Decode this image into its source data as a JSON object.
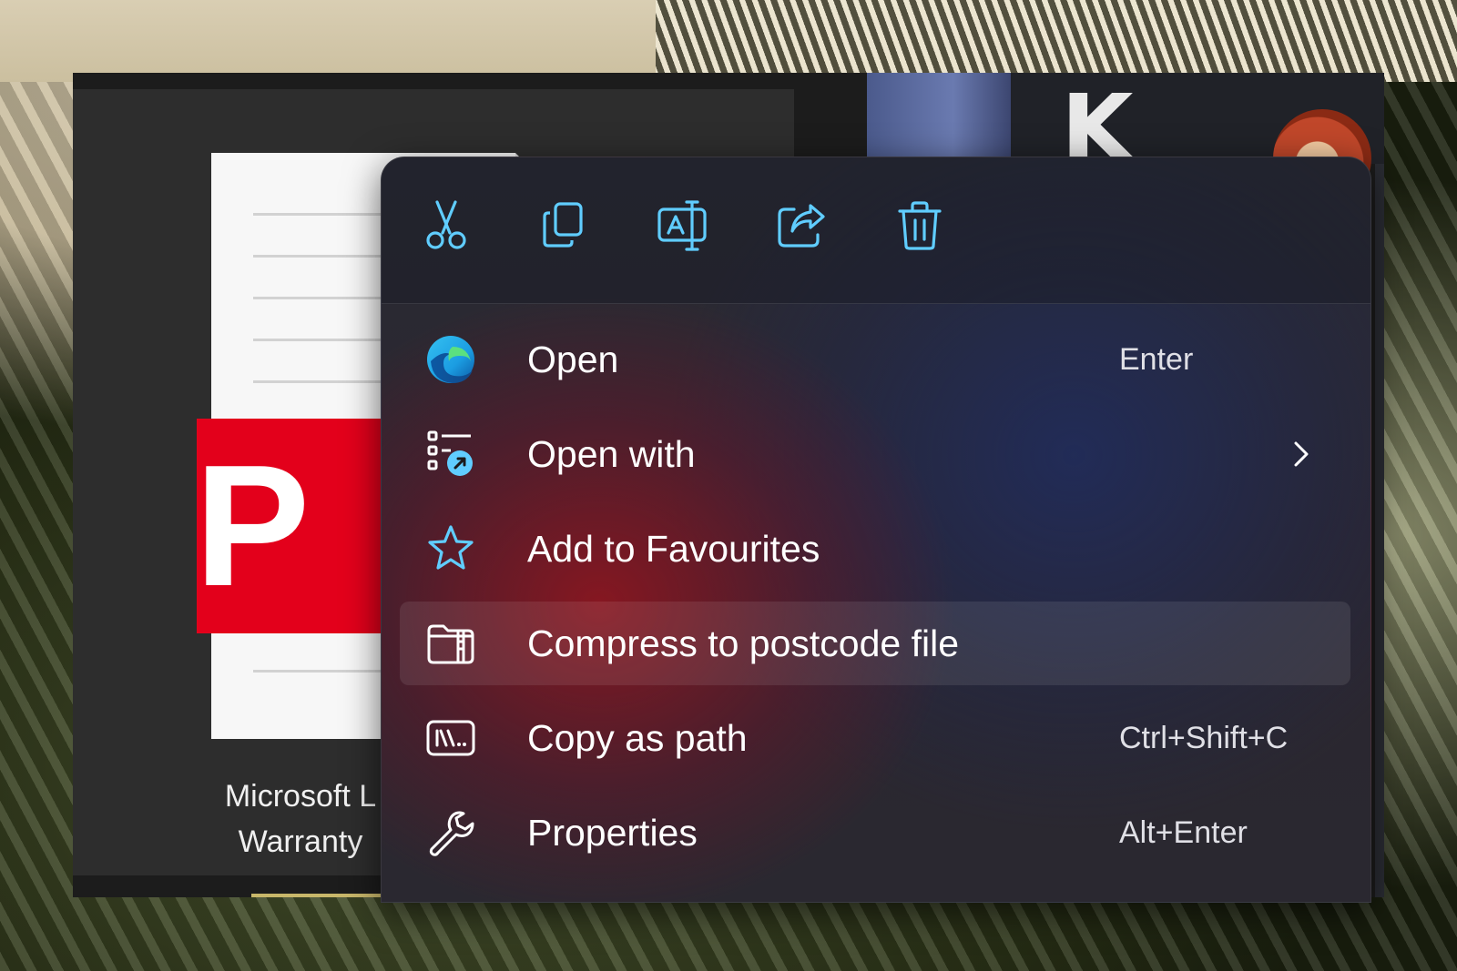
{
  "file": {
    "badge_letter": "P",
    "name": "Microsoft L\nWarranty"
  },
  "toolbar": {
    "buttons": [
      {
        "icon": "cut-icon"
      },
      {
        "icon": "copy-icon"
      },
      {
        "icon": "rename-icon"
      },
      {
        "icon": "share-icon"
      },
      {
        "icon": "delete-icon"
      }
    ]
  },
  "menu": {
    "items": [
      {
        "label": "Open",
        "shortcut": "Enter",
        "icon": "edge-icon"
      },
      {
        "label": "Open with",
        "shortcut": "",
        "icon": "open-with-icon",
        "submenu": true
      },
      {
        "label": "Add to Favourites",
        "shortcut": "",
        "icon": "star-icon"
      },
      {
        "label": "Compress to postcode file",
        "shortcut": "",
        "icon": "zip-folder-icon",
        "highlighted": true
      },
      {
        "label": "Copy as path",
        "shortcut": "Ctrl+Shift+C",
        "icon": "path-icon"
      },
      {
        "label": "Properties",
        "shortcut": "Alt+Enter",
        "icon": "wrench-icon"
      }
    ]
  },
  "colors": {
    "accent_icon": "#60cdff",
    "pdf_red": "#e3001b",
    "menu_text": "#ffffff"
  }
}
